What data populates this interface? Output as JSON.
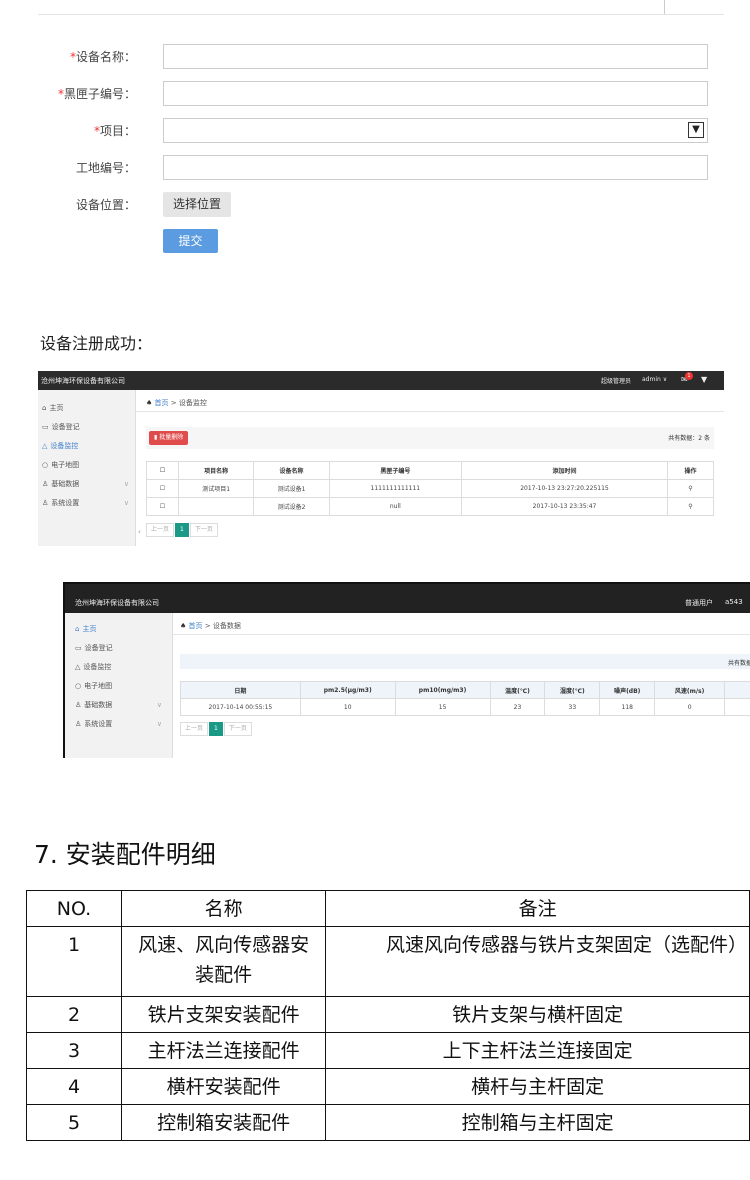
{
  "form": {
    "fields": [
      {
        "required": "*",
        "label": "设备名称："
      },
      {
        "required": "*",
        "label": "黑匣子编号："
      },
      {
        "required": "*",
        "label": "项目："
      },
      {
        "required": "",
        "label": "工地编号："
      }
    ],
    "location_label": "设备位置：",
    "location_button": "选择位置",
    "submit_button": "提交"
  },
  "success_text": "设备注册成功：",
  "shot1": {
    "company": "沧州坤海环保设备有限公司",
    "user_role": "超级管理员",
    "user_name": "admin ∨",
    "badge": "1",
    "sidebar": [
      "主页",
      "设备登记",
      "设备监控",
      "电子地图",
      "基础数据",
      "系统设置"
    ],
    "crumb_home": "首页",
    "crumb_sep": ">",
    "crumb_current": "设备监控",
    "batch_delete": "批量删除",
    "total": "共有数据：2 条",
    "headers": [
      "项目名称",
      "设备名称",
      "黑匣子编号",
      "添加时间",
      "操作"
    ],
    "rows": [
      [
        "测试项目1",
        "测试设备1",
        "1111111111111",
        "2017-10-13 23:27:20.225115"
      ],
      [
        "",
        "测试设备2",
        "null",
        "2017-10-13 23:35:47"
      ]
    ],
    "pager": [
      "上一页",
      "1",
      "下一页"
    ]
  },
  "shot2": {
    "company": "沧州坤海环保设备有限公司",
    "user_role": "普通用户",
    "user_name": "a543",
    "sidebar": [
      "主页",
      "设备登记",
      "设备监控",
      "电子地图",
      "基础数据",
      "系统设置"
    ],
    "crumb_home": "首页",
    "crumb_sep": ">",
    "crumb_current": "设备数据",
    "total": "共有数据",
    "headers": [
      "日期",
      "pm2.5(μg/m3)",
      "pm10(mg/m3)",
      "温度(℃)",
      "湿度(℃)",
      "噪声(dB)",
      "风速(m/s)"
    ],
    "row": [
      "2017-10-14 00:55:15",
      "10",
      "15",
      "23",
      "33",
      "118",
      "0"
    ],
    "pager": [
      "上一页",
      "1",
      "下一页"
    ]
  },
  "section7": {
    "title": "7. 安装配件明细",
    "headers": [
      "NO.",
      "名称",
      "备注"
    ],
    "rows": [
      {
        "no": "1",
        "name_line1": "风速、风向传感器安",
        "name_line2": "装配件",
        "note": "风速风向传感器与铁片支架固定（选配件）"
      },
      {
        "no": "2",
        "name_line1": "铁片支架安装配件",
        "name_line2": "",
        "note": "铁片支架与横杆固定"
      },
      {
        "no": "3",
        "name_line1": "主杆法兰连接配件",
        "name_line2": "",
        "note": "上下主杆法兰连接固定"
      },
      {
        "no": "4",
        "name_line1": "横杆安装配件",
        "name_line2": "",
        "note": "横杆与主杆固定"
      },
      {
        "no": "5",
        "name_line1": "控制箱安装配件",
        "name_line2": "",
        "note": "控制箱与主杆固定"
      }
    ]
  }
}
